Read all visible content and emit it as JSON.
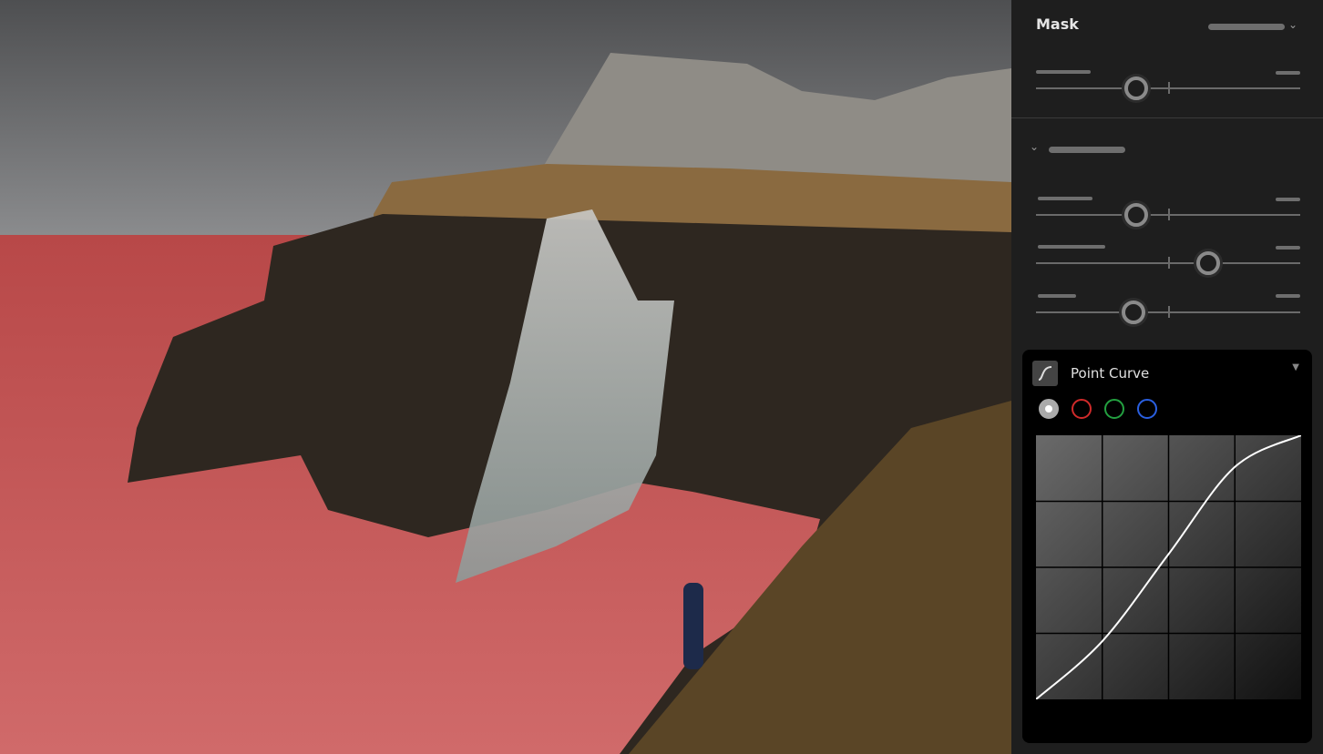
{
  "panel": {
    "mask_title": "Mask",
    "sliders": [
      {
        "value": 0.38
      },
      {
        "value": 0.38
      },
      {
        "value": 0.65
      },
      {
        "value": 0.37
      }
    ],
    "point_curve": {
      "label": "Point Curve",
      "channels": [
        {
          "name": "rgb",
          "color": "#cccccc",
          "selected": true
        },
        {
          "name": "red",
          "color": "#d02a2a"
        },
        {
          "name": "green",
          "color": "#23a040"
        },
        {
          "name": "blue",
          "color": "#2a5fe0"
        }
      ],
      "curve_points": [
        [
          0,
          0
        ],
        [
          0.25,
          0.22
        ],
        [
          0.5,
          0.55
        ],
        [
          0.75,
          0.88
        ],
        [
          1,
          1
        ]
      ]
    }
  },
  "colors": {
    "mask_overlay": "#d84a4a",
    "panel_bg": "#1e1e1e"
  }
}
